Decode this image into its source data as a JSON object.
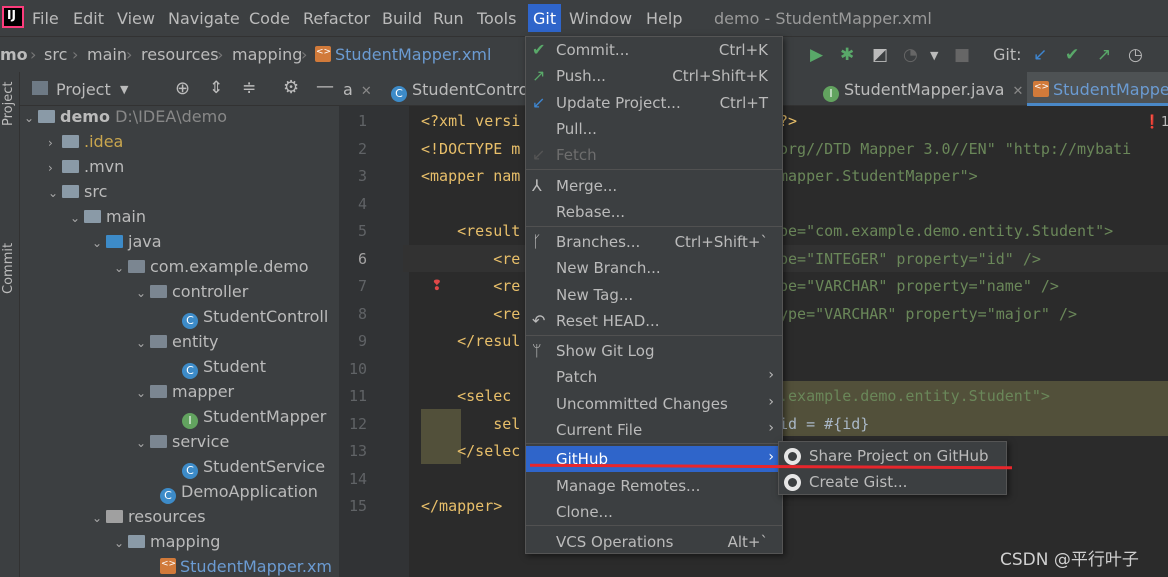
{
  "menubar": {
    "items": [
      "File",
      "Edit",
      "View",
      "Navigate",
      "Code",
      "Refactor",
      "Build",
      "Run",
      "Tools",
      "Git",
      "Window",
      "Help"
    ],
    "active": "Git",
    "window_title": "demo - StudentMapper.xml"
  },
  "navbar": {
    "crumbs": [
      "mo",
      "src",
      "main",
      "resources",
      "mapping",
      "StudentMapper.xml"
    ],
    "git_label": "Git:"
  },
  "left_stripe": {
    "project_label": "Project",
    "commit_label": "Commit"
  },
  "project_panel": {
    "title": "Project",
    "tree": [
      {
        "label": "demo",
        "extra": "D:\\IDEA\\demo",
        "kind": "root"
      },
      {
        "label": ".idea",
        "kind": "folder"
      },
      {
        "label": ".mvn",
        "kind": "folder"
      },
      {
        "label": "src",
        "kind": "folder"
      },
      {
        "label": "main",
        "kind": "folder"
      },
      {
        "label": "java",
        "kind": "folder-blue"
      },
      {
        "label": "com.example.demo",
        "kind": "package"
      },
      {
        "label": "controller",
        "kind": "package"
      },
      {
        "label": "StudentControll",
        "kind": "class"
      },
      {
        "label": "entity",
        "kind": "package"
      },
      {
        "label": "Student",
        "kind": "class"
      },
      {
        "label": "mapper",
        "kind": "package"
      },
      {
        "label": "StudentMapper",
        "kind": "interface"
      },
      {
        "label": "service",
        "kind": "package"
      },
      {
        "label": "StudentService",
        "kind": "class"
      },
      {
        "label": "DemoApplication",
        "kind": "class"
      },
      {
        "label": "resources",
        "kind": "folder-res"
      },
      {
        "label": "mapping",
        "kind": "folder"
      },
      {
        "label": "StudentMapper.xm",
        "kind": "xml"
      }
    ]
  },
  "editor": {
    "tabs": [
      {
        "label": "a",
        "active": false
      },
      {
        "label": "StudentControl",
        "active": false
      },
      {
        "label": "StudentMapper.java",
        "active": false
      },
      {
        "label": "StudentMappe",
        "active": true
      }
    ],
    "line_numbers": [
      "1",
      "2",
      "3",
      "4",
      "5",
      "6",
      "7",
      "8",
      "9",
      "10",
      "11",
      "12",
      "13",
      "14",
      "15"
    ],
    "code": {
      "l1a": "<?xml versi",
      "l1b": "?>",
      "l2a": "<!DOCTYPE m",
      "l2b": "org//DTD Mapper 3.0//EN\" \"http://mybati",
      "l3a": "<mapper nam",
      "l3b": "mapper.StudentMapper\">",
      "l5a": "    <result",
      "l5b": "pe=\"com.example.demo.entity.Student\">",
      "l6a": "        <re",
      "l6b": "pe=\"INTEGER\" property=\"id\" />",
      "l7a": "        <re",
      "l7b": "pe=\"VARCHAR\" property=\"name\" />",
      "l8a": "        <re",
      "l8b": "ype=\"VARCHAR\" property=\"major\" />",
      "l9a": "    </resul",
      "l11a": "    <selec",
      "l11b": ".example.demo.entity.Student\">",
      "l12a": "        sel",
      "l12b": "id = #{id}",
      "l13a": "    </selec",
      "l15a": "</mapper>"
    },
    "error_count": "1"
  },
  "git_menu": {
    "items": [
      {
        "label": "Commit...",
        "shortcut": "Ctrl+K",
        "icon": "check-icon"
      },
      {
        "label": "Push...",
        "shortcut": "Ctrl+Shift+K",
        "icon": "push-arrow-icon"
      },
      {
        "label": "Update Project...",
        "shortcut": "Ctrl+T",
        "icon": "update-arrow-icon"
      },
      {
        "label": "Pull...",
        "shortcut": ""
      },
      {
        "label": "Fetch",
        "shortcut": "",
        "disabled": true,
        "icon": "fetch-icon"
      },
      {
        "label": "Merge...",
        "shortcut": "",
        "icon": "merge-icon"
      },
      {
        "label": "Rebase...",
        "shortcut": ""
      },
      {
        "label": "Branches...",
        "shortcut": "Ctrl+Shift+`",
        "icon": "branch-icon"
      },
      {
        "label": "New Branch...",
        "shortcut": ""
      },
      {
        "label": "New Tag...",
        "shortcut": ""
      },
      {
        "label": "Reset HEAD...",
        "shortcut": "",
        "icon": "reset-icon"
      },
      {
        "label": "Show Git Log",
        "shortcut": "",
        "icon": "log-icon"
      },
      {
        "label": "Patch",
        "shortcut": "",
        "submenu": true
      },
      {
        "label": "Uncommitted Changes",
        "shortcut": "",
        "submenu": true
      },
      {
        "label": "Current File",
        "shortcut": "",
        "submenu": true
      },
      {
        "label": "GitHub",
        "shortcut": "",
        "submenu": true,
        "highlighted": true
      },
      {
        "label": "Manage Remotes...",
        "shortcut": ""
      },
      {
        "label": "Clone...",
        "shortcut": ""
      },
      {
        "label": "VCS Operations",
        "shortcut": "Alt+`"
      }
    ]
  },
  "github_submenu": {
    "items": [
      {
        "label": "Share Project on GitHub",
        "icon": "github-icon"
      },
      {
        "label": "Create Gist...",
        "icon": "github-icon"
      }
    ]
  },
  "watermark": "CSDN @平行叶子",
  "colors": {
    "menu_bg": "#3c3f41",
    "editor_bg": "#2b2b2b",
    "highlight": "#2f65ca",
    "annotation_red": "#e8262c"
  }
}
